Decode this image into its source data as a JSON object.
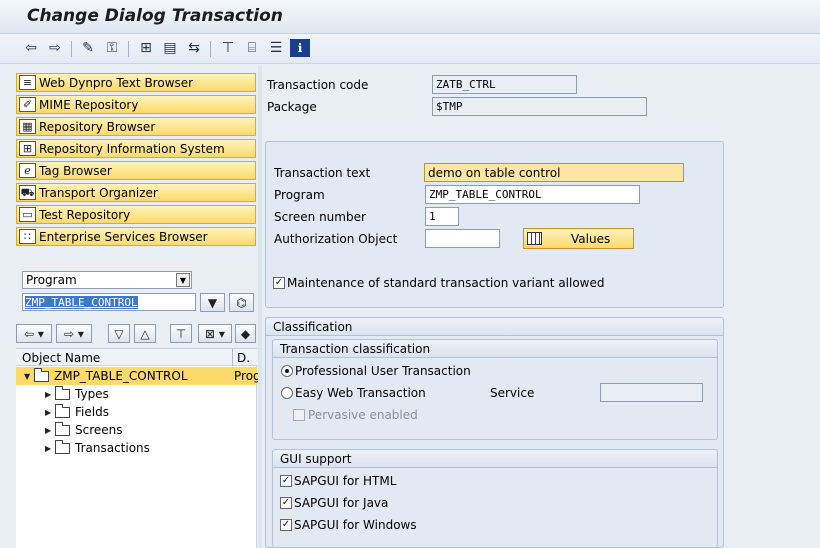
{
  "window": {
    "title": "Change Dialog Transaction"
  },
  "toolbar": {
    "buttons": [
      {
        "name": "back-icon",
        "glyph": "⇦"
      },
      {
        "name": "forward-icon",
        "glyph": "⇨"
      },
      {
        "name": "display-change-icon",
        "glyph": "✎"
      },
      {
        "name": "active-inactive-icon",
        "glyph": "⚿"
      },
      {
        "name": "object-list-icon",
        "glyph": "⊞"
      },
      {
        "name": "display-object-icon",
        "glyph": "▤"
      },
      {
        "name": "where-used-icon",
        "glyph": "⇆"
      },
      {
        "name": "hierarchy-icon",
        "glyph": "⊤"
      },
      {
        "name": "print-icon",
        "glyph": "⌸"
      },
      {
        "name": "details-icon",
        "glyph": "☰"
      },
      {
        "name": "info-icon",
        "glyph": "ℹ"
      }
    ]
  },
  "nav": {
    "items": [
      {
        "label": "Web Dynpro Text Browser",
        "icon": "web-dynpro-icon",
        "glyph": "≡"
      },
      {
        "label": "MIME Repository",
        "icon": "mime-icon",
        "glyph": "✐"
      },
      {
        "label": "Repository Browser",
        "icon": "repository-icon",
        "glyph": "▦"
      },
      {
        "label": "Repository Information System",
        "icon": "info-system-icon",
        "glyph": "⊞"
      },
      {
        "label": "Tag Browser",
        "icon": "tag-icon",
        "glyph": "ℯ"
      },
      {
        "label": "Transport Organizer",
        "icon": "truck-icon",
        "glyph": "⛟"
      },
      {
        "label": "Test Repository",
        "icon": "test-icon",
        "glyph": "▭"
      },
      {
        "label": "Enterprise Services Browser",
        "icon": "services-icon",
        "glyph": "∷"
      }
    ],
    "object_type": "Program",
    "object_name": "ZMP_TABLE_CONTROL"
  },
  "tree": {
    "header": {
      "name": "Object Name",
      "desc": "D."
    },
    "root": {
      "label": "ZMP_TABLE_CONTROL",
      "desc": "Prog"
    },
    "children": [
      "Types",
      "Fields",
      "Screens",
      "Transactions"
    ]
  },
  "form": {
    "transaction_code_label": "Transaction code",
    "transaction_code": "ZATB_CTRL",
    "package_label": "Package",
    "package": "$TMP",
    "transaction_text_label": "Transaction text",
    "transaction_text": "demo on table control",
    "program_label": "Program",
    "program": "ZMP_TABLE_CONTROL",
    "screen_number_label": "Screen number",
    "screen_number": "1",
    "authorization_label": "Authorization Object",
    "authorization": "",
    "values_button": "Values",
    "maintenance_label": "Maintenance of standard transaction variant allowed"
  },
  "classification": {
    "title": "Classification",
    "tc_title": "Transaction classification",
    "professional": "Professional User Transaction",
    "easy_web": "Easy Web Transaction",
    "service_label": "Service",
    "pervasive": "Pervasive enabled",
    "gui_title": "GUI support",
    "gui_html": "SAPGUI for HTML",
    "gui_java": "SAPGUI for Java",
    "gui_windows": "SAPGUI for Windows"
  }
}
